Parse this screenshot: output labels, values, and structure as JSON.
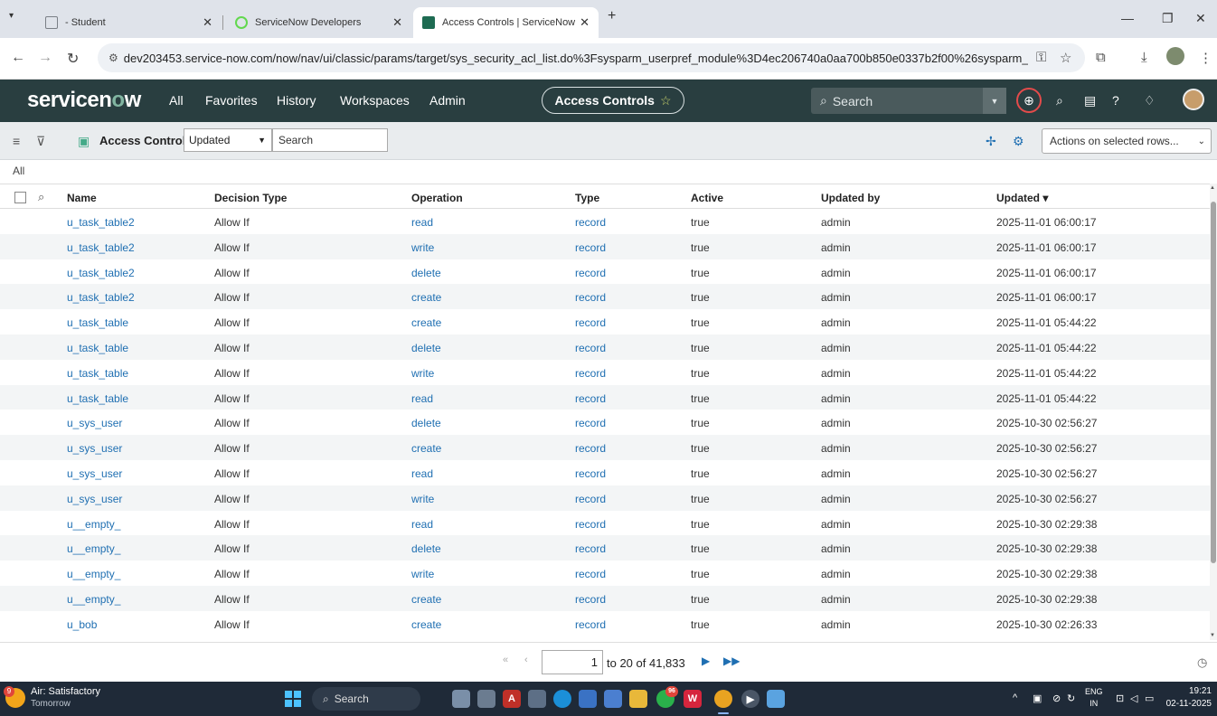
{
  "browser": {
    "tabs": [
      {
        "label": "- Student",
        "color": "#7a7f86"
      },
      {
        "label": "ServiceNow Developers",
        "color": "#62d84e"
      },
      {
        "label": "Access Controls | ServiceNow",
        "color": "#1e6b52"
      }
    ],
    "new_tab": "+",
    "url": "dev203453.service-now.com/now/nav/ui/classic/params/target/sys_security_acl_list.do%3Fsysparm_userpref_module%3D4ec206740a0aa700b850e0337b2f00%26sysparm_clear_st..."
  },
  "sn_header": {
    "logo_prefix": "servicen",
    "logo_o": "o",
    "logo_suffix": "w",
    "nav": [
      "All",
      "Favorites",
      "History",
      "Workspaces",
      "Admin"
    ],
    "context_title": "Access Controls",
    "search_placeholder": "Search"
  },
  "list_controls": {
    "title": "Access Controls",
    "field_select": "Updated",
    "search_placeholder": "Search",
    "actions_select": "Actions on selected rows..."
  },
  "breadcrumb": "All",
  "columns": {
    "name": "Name",
    "decision_type": "Decision Type",
    "operation": "Operation",
    "type": "Type",
    "active": "Active",
    "updated_by": "Updated by",
    "updated": "Updated"
  },
  "rows": [
    {
      "name": "u_task_table2",
      "decision": "Allow If",
      "operation": "read",
      "type": "record",
      "active": "true",
      "updated_by": "admin",
      "updated": "2025-11-01 06:00:17"
    },
    {
      "name": "u_task_table2",
      "decision": "Allow If",
      "operation": "write",
      "type": "record",
      "active": "true",
      "updated_by": "admin",
      "updated": "2025-11-01 06:00:17"
    },
    {
      "name": "u_task_table2",
      "decision": "Allow If",
      "operation": "delete",
      "type": "record",
      "active": "true",
      "updated_by": "admin",
      "updated": "2025-11-01 06:00:17"
    },
    {
      "name": "u_task_table2",
      "decision": "Allow If",
      "operation": "create",
      "type": "record",
      "active": "true",
      "updated_by": "admin",
      "updated": "2025-11-01 06:00:17"
    },
    {
      "name": "u_task_table",
      "decision": "Allow If",
      "operation": "create",
      "type": "record",
      "active": "true",
      "updated_by": "admin",
      "updated": "2025-11-01 05:44:22"
    },
    {
      "name": "u_task_table",
      "decision": "Allow If",
      "operation": "delete",
      "type": "record",
      "active": "true",
      "updated_by": "admin",
      "updated": "2025-11-01 05:44:22"
    },
    {
      "name": "u_task_table",
      "decision": "Allow If",
      "operation": "write",
      "type": "record",
      "active": "true",
      "updated_by": "admin",
      "updated": "2025-11-01 05:44:22"
    },
    {
      "name": "u_task_table",
      "decision": "Allow If",
      "operation": "read",
      "type": "record",
      "active": "true",
      "updated_by": "admin",
      "updated": "2025-11-01 05:44:22"
    },
    {
      "name": "u_sys_user",
      "decision": "Allow If",
      "operation": "delete",
      "type": "record",
      "active": "true",
      "updated_by": "admin",
      "updated": "2025-10-30 02:56:27"
    },
    {
      "name": "u_sys_user",
      "decision": "Allow If",
      "operation": "create",
      "type": "record",
      "active": "true",
      "updated_by": "admin",
      "updated": "2025-10-30 02:56:27"
    },
    {
      "name": "u_sys_user",
      "decision": "Allow If",
      "operation": "read",
      "type": "record",
      "active": "true",
      "updated_by": "admin",
      "updated": "2025-10-30 02:56:27"
    },
    {
      "name": "u_sys_user",
      "decision": "Allow If",
      "operation": "write",
      "type": "record",
      "active": "true",
      "updated_by": "admin",
      "updated": "2025-10-30 02:56:27"
    },
    {
      "name": "u__empty_",
      "decision": "Allow If",
      "operation": "read",
      "type": "record",
      "active": "true",
      "updated_by": "admin",
      "updated": "2025-10-30 02:29:38"
    },
    {
      "name": "u__empty_",
      "decision": "Allow If",
      "operation": "delete",
      "type": "record",
      "active": "true",
      "updated_by": "admin",
      "updated": "2025-10-30 02:29:38"
    },
    {
      "name": "u__empty_",
      "decision": "Allow If",
      "operation": "write",
      "type": "record",
      "active": "true",
      "updated_by": "admin",
      "updated": "2025-10-30 02:29:38"
    },
    {
      "name": "u__empty_",
      "decision": "Allow If",
      "operation": "create",
      "type": "record",
      "active": "true",
      "updated_by": "admin",
      "updated": "2025-10-30 02:29:38"
    },
    {
      "name": "u_bob",
      "decision": "Allow If",
      "operation": "create",
      "type": "record",
      "active": "true",
      "updated_by": "admin",
      "updated": "2025-10-30 02:26:33"
    }
  ],
  "pagination": {
    "page_value": "1",
    "range_text": "to 20 of 41,833"
  },
  "taskbar": {
    "weather_title": "Air: Satisfactory",
    "weather_sub": "Tomorrow",
    "weather_badge": "9",
    "search_label": "Search",
    "lang_top": "ENG",
    "lang_bottom": "IN",
    "time": "19:21",
    "date": "02-11-2025",
    "whatsapp_badge": "96"
  },
  "colors": {
    "header_bg": "#293e40",
    "link": "#1f6fb2",
    "row_stripe": "#f3f5f6"
  }
}
